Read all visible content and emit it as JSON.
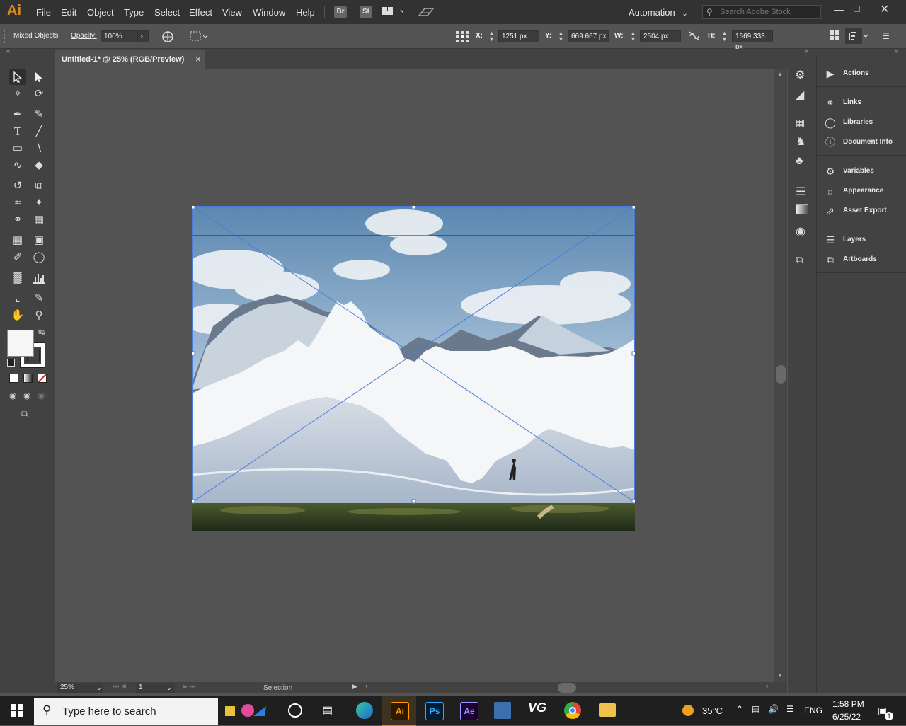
{
  "app": {
    "logo": "Ai"
  },
  "menu": [
    "File",
    "Edit",
    "Object",
    "Type",
    "Select",
    "Effect",
    "View",
    "Window",
    "Help"
  ],
  "bridge_label": "Br",
  "stock_label": "St",
  "workspace": "Automation",
  "stock_search": {
    "placeholder": "Search Adobe Stock"
  },
  "control": {
    "selection_type": "Mixed Objects",
    "opacity_label": "Opacity:",
    "opacity_value": "100%",
    "x_label": "X:",
    "x_value": "1251 px",
    "y_label": "Y:",
    "y_value": "669.667 px",
    "w_label": "W:",
    "w_value": "2504 px",
    "h_label": "H:",
    "h_value": "1669.333 px"
  },
  "document_tab": {
    "title": "Untitled-1* @ 25% (RGB/Preview)",
    "close": "×"
  },
  "status": {
    "zoom": "25%",
    "artboard": "1",
    "tool": "Selection"
  },
  "panels": [
    {
      "label": "Actions",
      "icon": "play-icon"
    },
    {
      "label": "Links",
      "icon": "link-icon"
    },
    {
      "label": "Libraries",
      "icon": "libraries-icon"
    },
    {
      "label": "Document Info",
      "icon": "info-icon"
    },
    {
      "label": "Variables",
      "icon": "variables-icon"
    },
    {
      "label": "Appearance",
      "icon": "appearance-icon"
    },
    {
      "label": "Asset Export",
      "icon": "export-icon"
    },
    {
      "label": "Layers",
      "icon": "layers-icon"
    },
    {
      "label": "Artboards",
      "icon": "artboards-icon"
    }
  ],
  "taskbar": {
    "search_placeholder": "Type here to search",
    "weather": "35°C",
    "language": "ENG",
    "time": "1:58 PM",
    "date": "6/25/22",
    "notification_count": "1",
    "apps": [
      "Ai",
      "Ps",
      "Ae"
    ]
  },
  "colors": {
    "accent": "#d98c1c",
    "selection": "#4a7bd9"
  }
}
